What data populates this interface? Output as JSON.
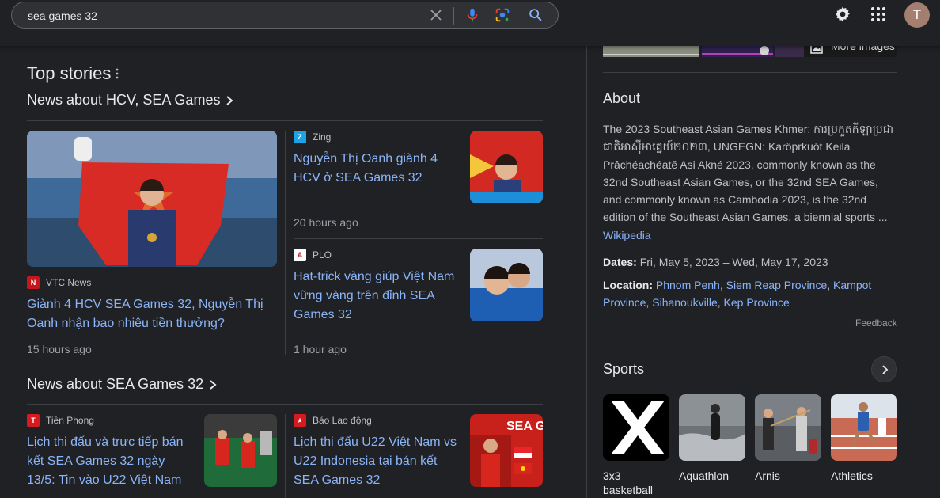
{
  "search": {
    "query": "sea games 32"
  },
  "account": {
    "avatar_letter": "T"
  },
  "top_stories": {
    "title": "Top stories",
    "section1": {
      "heading": "News about HCV, SEA Games",
      "main": {
        "source": "VTC News",
        "headline": "Giành 4 HCV SEA Games 32, Nguyễn Thị Oanh nhận bao nhiêu tiền thưởng?",
        "time": "15 hours ago"
      },
      "story2": {
        "source": "Zing",
        "headline": "Nguyễn Thị Oanh giành 4 HCV ở SEA Games 32",
        "time": "20 hours ago"
      },
      "story3": {
        "source": "PLO",
        "headline": "Hat-trick vàng giúp Việt Nam vững vàng trên đỉnh SEA Games 32",
        "time": "1 hour ago"
      }
    },
    "section2": {
      "heading": "News about SEA Games 32",
      "story1": {
        "source": "Tiền Phong",
        "headline": "Lịch thi đấu và trực tiếp bán kết SEA Games 32 ngày 13/5: Tin vào U22 Việt Nam"
      },
      "story2": {
        "source": "Báo Lao động",
        "headline": "Lịch thi đấu U22 Việt Nam vs U22 Indonesia tại bán kết SEA Games 32"
      }
    }
  },
  "knowledge_panel": {
    "more_images": "More images",
    "about": {
      "title": "About",
      "text": "The 2023 Southeast Asian Games Khmer: ការប្រកួតកីឡាប្រជាជាតិអាស៊ីអាគ្នេយ៍២០២៣, UNGEGN: Karôprkuŏt Keila Prâchéachéatĕ Asi Akné 2023, commonly known as the 32nd Southeast Asian Games, or the 32nd SEA Games, and commonly known as Cambodia 2023, is the 32nd edition of the Southeast Asian Games, a biennial sports ...",
      "source_link": "Wikipedia"
    },
    "dates": {
      "label": "Dates:",
      "value": "Fri, May 5, 2023 – Wed, May 17, 2023"
    },
    "location": {
      "label": "Location:",
      "places": [
        "Phnom Penh",
        "Siem Reap Province",
        "Kampot Province",
        "Sihanoukville",
        "Kep Province"
      ]
    },
    "feedback": "Feedback",
    "sports": {
      "title": "Sports",
      "items": [
        {
          "label": "3x3 basketball"
        },
        {
          "label": "Aquathlon"
        },
        {
          "label": "Arnis"
        },
        {
          "label": "Athletics"
        }
      ]
    }
  }
}
